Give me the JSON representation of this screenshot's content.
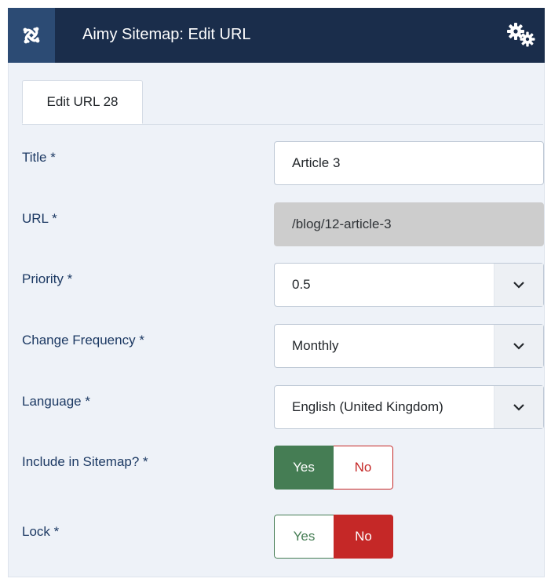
{
  "header": {
    "title": "Aimy Sitemap: Edit URL",
    "logo_icon": "joomla-logo-icon",
    "options_icon": "gears-icon",
    "background_color": "#1a2d4b"
  },
  "tabs": [
    {
      "label": "Edit URL 28",
      "active": true
    }
  ],
  "form": {
    "title": {
      "label": "Title *",
      "value": "Article 3"
    },
    "url": {
      "label": "URL *",
      "value": "/blog/12-article-3",
      "readonly": true
    },
    "priority": {
      "label": "Priority *",
      "value": "0.5"
    },
    "change_frequency": {
      "label": "Change Frequency *",
      "value": "Monthly"
    },
    "language": {
      "label": "Language *",
      "value": "English (United Kingdom)"
    },
    "include_in_sitemap": {
      "label": "Include in Sitemap? *",
      "yes_label": "Yes",
      "no_label": "No",
      "selected": "Yes"
    },
    "lock": {
      "label": "Lock *",
      "yes_label": "Yes",
      "no_label": "No",
      "selected": "No"
    }
  },
  "colors": {
    "label": "#1c3963",
    "yes_active": "#457d54",
    "no_active": "#c52827",
    "readonly_bg": "#cdcdcd"
  }
}
